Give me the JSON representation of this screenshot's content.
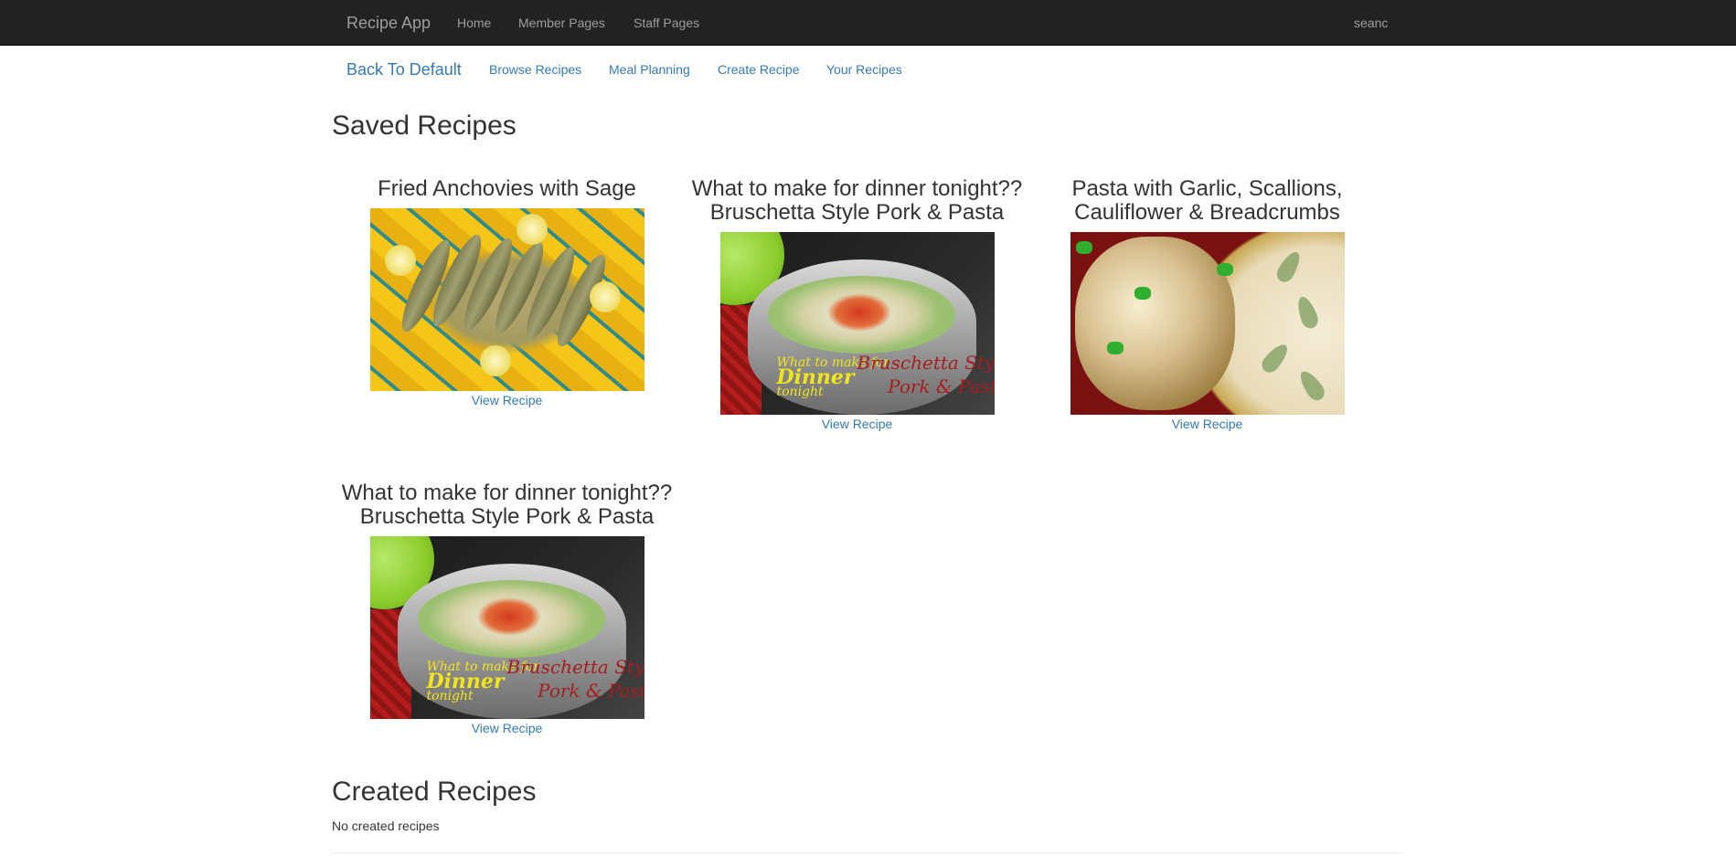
{
  "navbar": {
    "brand": "Recipe App",
    "items": [
      "Home",
      "Member Pages",
      "Staff Pages"
    ],
    "user": "seanc"
  },
  "subnav": {
    "back": "Back To Default",
    "links": [
      "Browse Recipes",
      "Meal Planning",
      "Create Recipe",
      "Your Recipes"
    ]
  },
  "saved": {
    "title": "Saved Recipes",
    "recipes": [
      {
        "title": "Fried Anchovies with Sage",
        "link": "View Recipe"
      },
      {
        "title": "What to make for dinner tonight?? Bruschetta Style Pork & Pasta",
        "link": "View Recipe"
      },
      {
        "title": "Pasta with Garlic, Scallions, Cauliflower & Breadcrumbs",
        "link": "View Recipe"
      },
      {
        "title": "What to make for dinner tonight?? Bruschetta Style Pork & Pasta",
        "link": "View Recipe"
      }
    ]
  },
  "created": {
    "title": "Created Recipes",
    "empty_message": "No created recipes"
  },
  "photo_text": {
    "line1": "What to make for",
    "line2": "Dinner",
    "line3": "tonight",
    "red1": "Bruschetta Style",
    "red2": "Pork & Pasta"
  },
  "colors": {
    "navbar_bg": "#222222",
    "navbar_text": "#9d9d9d",
    "link": "#337ab7",
    "heading": "#333333"
  }
}
